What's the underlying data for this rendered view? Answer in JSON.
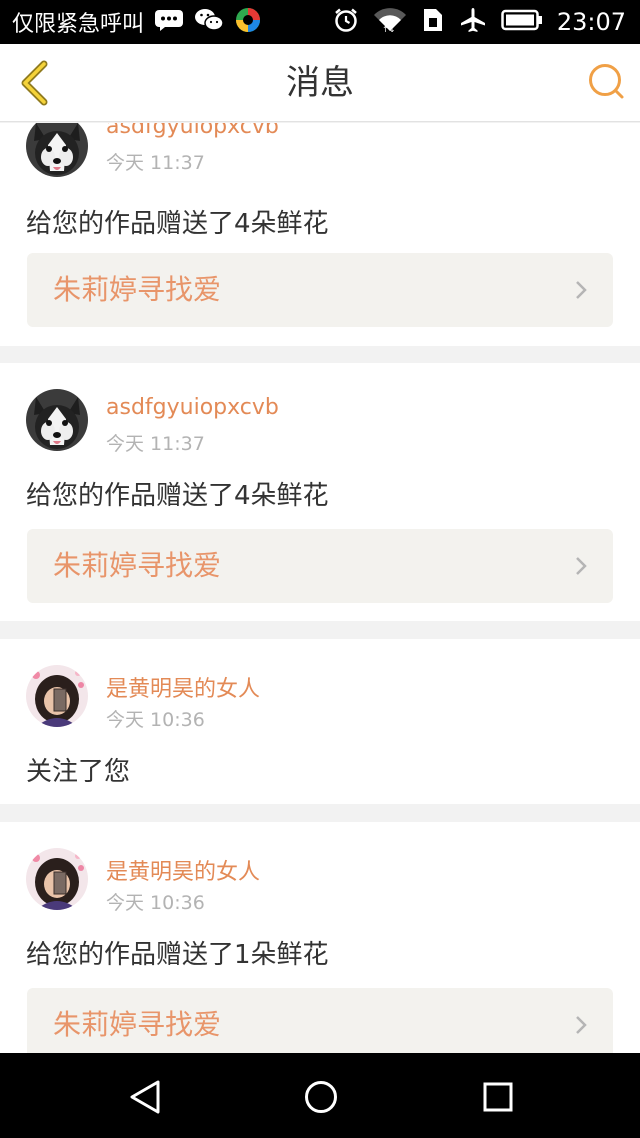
{
  "status_bar": {
    "carrier": "仅限紧急呼叫",
    "time": "23:07",
    "icons": [
      "message-icon",
      "wechat-icon",
      "app-icon",
      "alarm-icon",
      "wifi-icon",
      "sim-icon",
      "airplane-icon",
      "battery-icon"
    ]
  },
  "header": {
    "title": "消息",
    "back_icon": "chevron-left-icon",
    "search_icon": "search-icon"
  },
  "colors": {
    "accent": "#e38a56",
    "link_bg": "#f3f2ee",
    "timestamp": "#b3b3b3"
  },
  "messages": [
    {
      "username": "asdfgyuiopxcvb",
      "time": "今天 11:37",
      "text": "给您的作品赠送了4朵鲜花",
      "work_title": "朱莉婷寻找爱"
    },
    {
      "username": "asdfgyuiopxcvb",
      "time": "今天 11:37",
      "text": "给您的作品赠送了4朵鲜花",
      "work_title": "朱莉婷寻找爱"
    },
    {
      "username": "是黄明昊的女人",
      "time": "今天 10:36",
      "text": "关注了您"
    },
    {
      "username": "是黄明昊的女人",
      "time": "今天 10:36",
      "text": "给您的作品赠送了1朵鲜花",
      "work_title": "朱莉婷寻找爱"
    }
  ],
  "nav_bar": {
    "icons": [
      "back-triangle-icon",
      "home-circle-icon",
      "recents-square-icon"
    ]
  }
}
